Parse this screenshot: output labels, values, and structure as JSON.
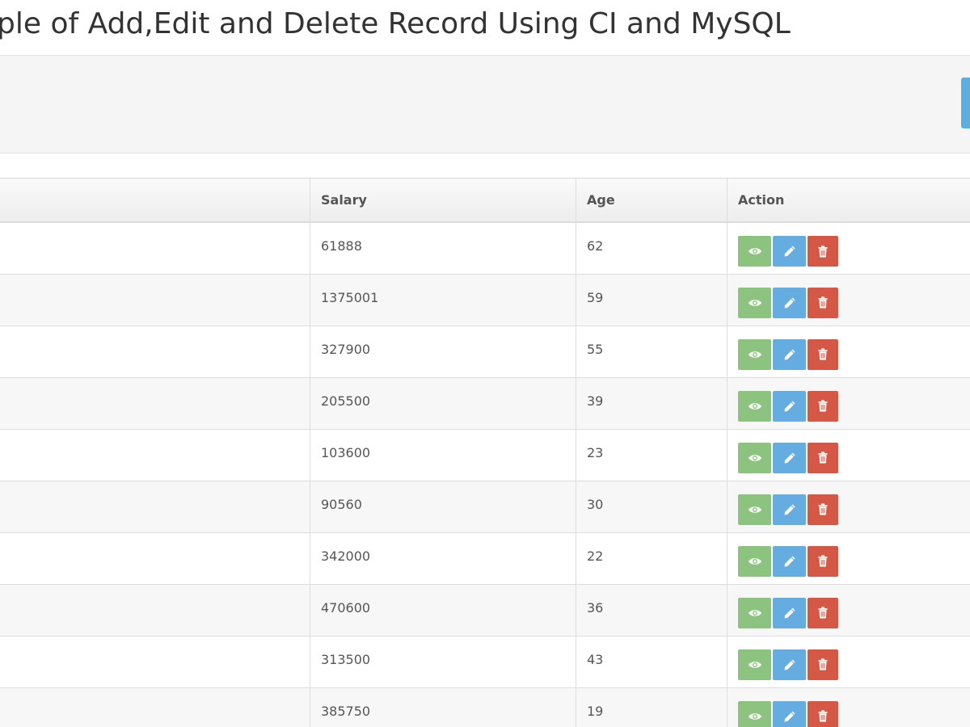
{
  "page": {
    "title": "ple of Add,Edit and Delete Record Using CI and MySQL"
  },
  "table": {
    "columns": [
      "",
      "Salary",
      "Age",
      "Action"
    ],
    "rows": [
      {
        "salary": "61888",
        "age": "62"
      },
      {
        "salary": "1375001",
        "age": "59"
      },
      {
        "salary": "327900",
        "age": "55"
      },
      {
        "salary": "205500",
        "age": "39"
      },
      {
        "salary": "103600",
        "age": "23"
      },
      {
        "salary": "90560",
        "age": "30"
      },
      {
        "salary": "342000",
        "age": "22"
      },
      {
        "salary": "470600",
        "age": "36"
      },
      {
        "salary": "313500",
        "age": "43"
      },
      {
        "salary": "385750",
        "age": "19"
      }
    ]
  },
  "icons": {
    "view": "eye-icon",
    "edit": "pencil-icon",
    "delete": "trash-icon"
  },
  "colors": {
    "view": "#8cc47f",
    "edit": "#65ace0",
    "delete": "#d55745",
    "add": "#5aaee0"
  }
}
